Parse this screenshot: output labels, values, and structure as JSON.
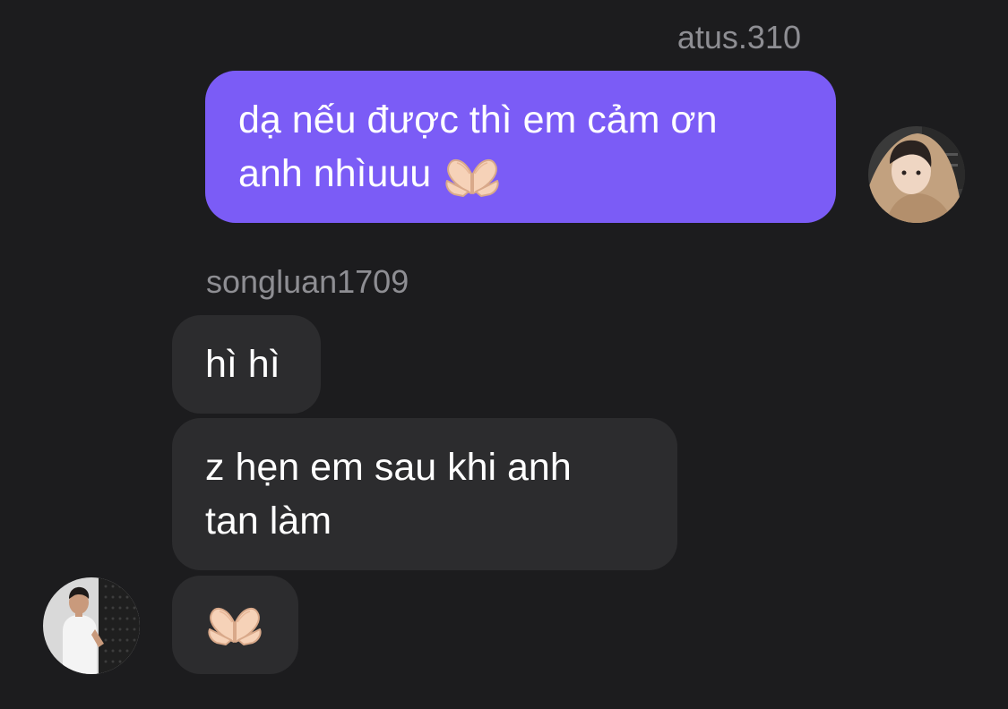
{
  "conversation": {
    "outgoing": {
      "username": "atus.310",
      "message_lines": [
        "dạ nếu được thì em cảm ơn",
        "anh nhìuuu"
      ],
      "emoji": "heart-hands-icon",
      "bubble_color": "#7b5cf6"
    },
    "incoming": {
      "username": "songluan1709",
      "bubble_color": "#2c2c2e",
      "messages": [
        {
          "lines": [
            "hì hì"
          ]
        },
        {
          "lines": [
            "z hẹn em sau khi anh",
            "tan làm"
          ]
        },
        {
          "emoji": "heart-hands-icon"
        }
      ]
    }
  },
  "colors": {
    "background": "#1c1c1e",
    "username": "#8e8e93",
    "text": "#ffffff"
  }
}
